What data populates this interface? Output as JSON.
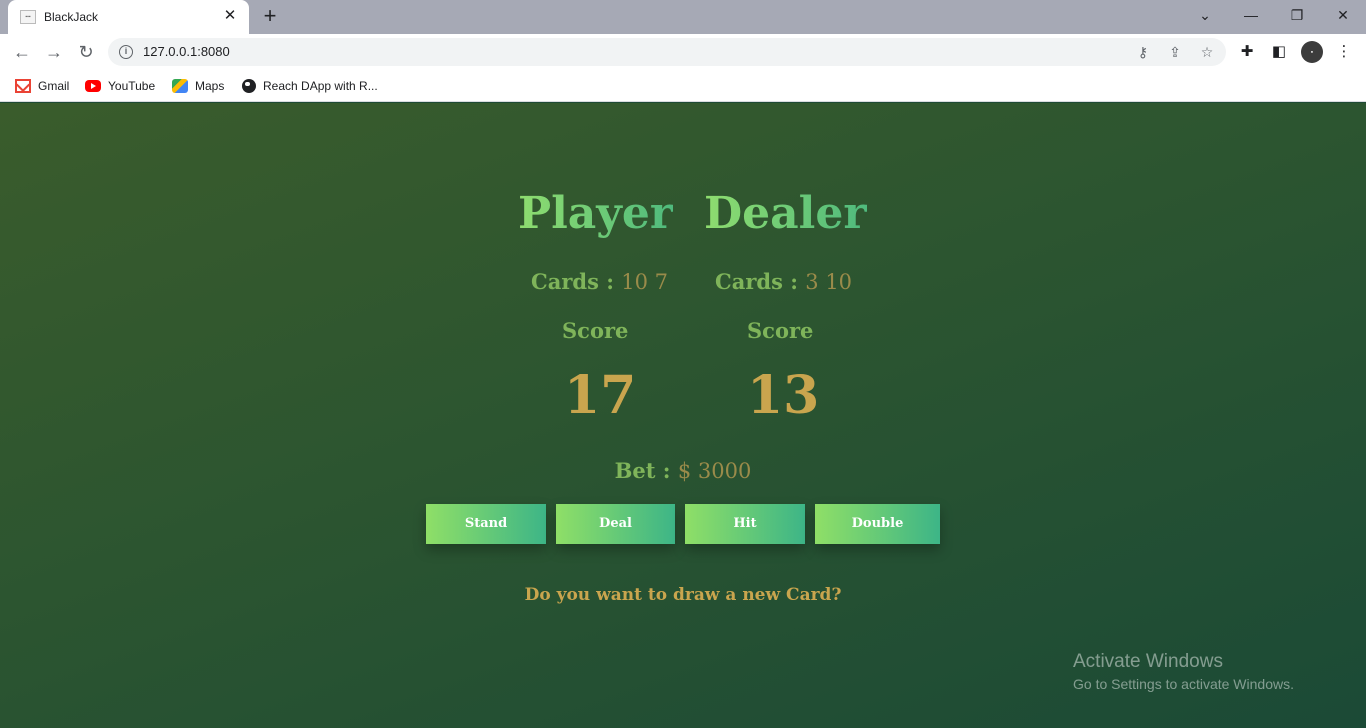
{
  "browser": {
    "tab_title": "BlackJack",
    "url": "127.0.0.1:8080",
    "bookmarks": [
      {
        "label": "Gmail",
        "icon": "gmail-icon"
      },
      {
        "label": "YouTube",
        "icon": "youtube-icon"
      },
      {
        "label": "Maps",
        "icon": "maps-icon"
      },
      {
        "label": "Reach DApp with R...",
        "icon": "globe-icon"
      }
    ]
  },
  "game": {
    "player": {
      "heading": "Player",
      "cards_label": "Cards :",
      "cards": "10 7",
      "score_label": "Score",
      "score": "17"
    },
    "dealer": {
      "heading": "Dealer",
      "cards_label": "Cards :",
      "cards": "3 10",
      "score_label": "Score",
      "score": "13"
    },
    "bet_label": "Bet :",
    "bet_value": "$ 3000",
    "buttons": {
      "stand": "Stand",
      "deal": "Deal",
      "hit": "Hit",
      "double": "Double"
    },
    "prompt": "Do you want to draw a new Card?"
  },
  "watermark": {
    "title": "Activate Windows",
    "subtitle": "Go to Settings to activate Windows."
  },
  "colors": {
    "background": "#2c5530",
    "heading_gradient_start": "#8fdd6f",
    "heading_gradient_end": "#4fba7d",
    "label_green": "#7fb45a",
    "score_gold": "#c9a54e",
    "button_gradient_start": "#8fdf67",
    "button_gradient_end": "#3db587"
  }
}
